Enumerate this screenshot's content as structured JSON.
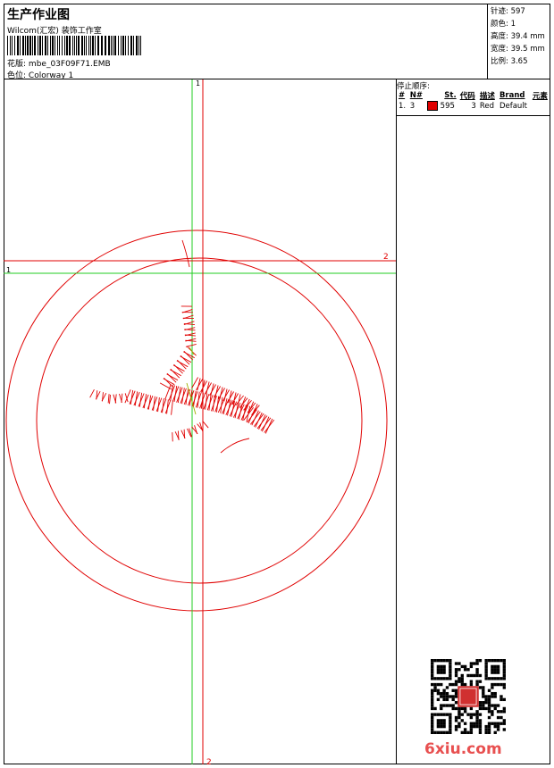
{
  "header": {
    "title": "生产作业图",
    "company": "Wilcom(汇宏) 装饰工作室",
    "pattern_label": "花版:",
    "pattern_value": "mbe_03F09F71.EMB",
    "colorway_label": "色位:",
    "colorway_value": "Colorway 1"
  },
  "stats": {
    "stitches": "针迹: 597",
    "colors": "颜色: 1",
    "height": "高度: 39.4 mm",
    "width": "宽度: 39.5 mm",
    "ratio": "比例: 3.65"
  },
  "guides": {
    "v_green": "1",
    "h_green": "1",
    "h_red": "2",
    "v_red": "2"
  },
  "sequence": {
    "title": "停止顺序:",
    "headers": [
      "#",
      "N#",
      "St.",
      "代码",
      "描述",
      "Brand",
      "元素"
    ],
    "rows": [
      {
        "num": "1.",
        "needle": "3",
        "color": "#e00000",
        "stitches": "595",
        "code": "3",
        "desc": "Red",
        "brand": "Default",
        "element": ""
      }
    ]
  },
  "watermark": {
    "text": "6xiu.com",
    "qr_seal": "图书"
  },
  "colors": {
    "thread": "#e00000",
    "guide_green": "#22cc22",
    "guide_red": "#e00000"
  }
}
